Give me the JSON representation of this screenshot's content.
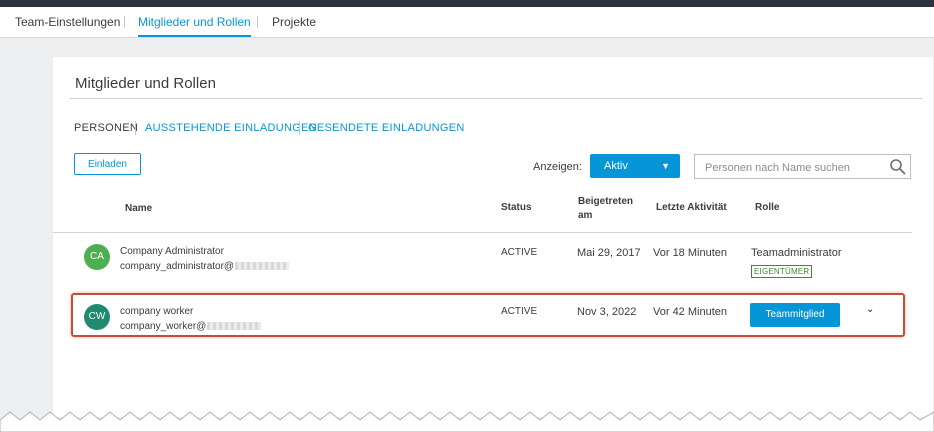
{
  "top_tabs": [
    {
      "label": "Team-Einstellungen"
    },
    {
      "label": "Mitglieder und Rollen"
    },
    {
      "label": "Projekte"
    }
  ],
  "card": {
    "title": "Mitglieder und Rollen",
    "subtabs": [
      {
        "label": "PERSONEN"
      },
      {
        "label": "AUSSTEHENDE EINLADUNGEN"
      },
      {
        "label": "GESENDETE EINLADUNGEN"
      }
    ],
    "invite_button": "Einladen",
    "show_label": "Anzeigen:",
    "show_value": "Aktiv",
    "search_placeholder": "Personen nach Name suchen"
  },
  "table": {
    "headers": {
      "name": "Name",
      "status": "Status",
      "joined_line1": "Beigetreten",
      "joined_line2": "am",
      "last_activity": "Letzte Aktivität",
      "role": "Rolle"
    },
    "rows": [
      {
        "initials": "CA",
        "avatar_color": "#4caf50",
        "name": "Company Administrator",
        "email_prefix": "company_administrator@",
        "status": "ACTIVE",
        "joined": "Mai 29, 2017",
        "last_activity": "Vor 18 Minuten",
        "role": "Teamadministrator",
        "badge": "EIGENTÜMER"
      },
      {
        "initials": "CW",
        "avatar_color": "#1e8a6e",
        "name": "company worker",
        "email_prefix": "company_worker@",
        "status": "ACTIVE",
        "joined": "Nov 3, 2022",
        "last_activity": "Vor 42 Minuten",
        "role": "Teammitglied"
      }
    ]
  },
  "colors": {
    "accent": "#0696d7",
    "highlight": "#c0503a",
    "owner_badge": "#3a8c2f"
  }
}
